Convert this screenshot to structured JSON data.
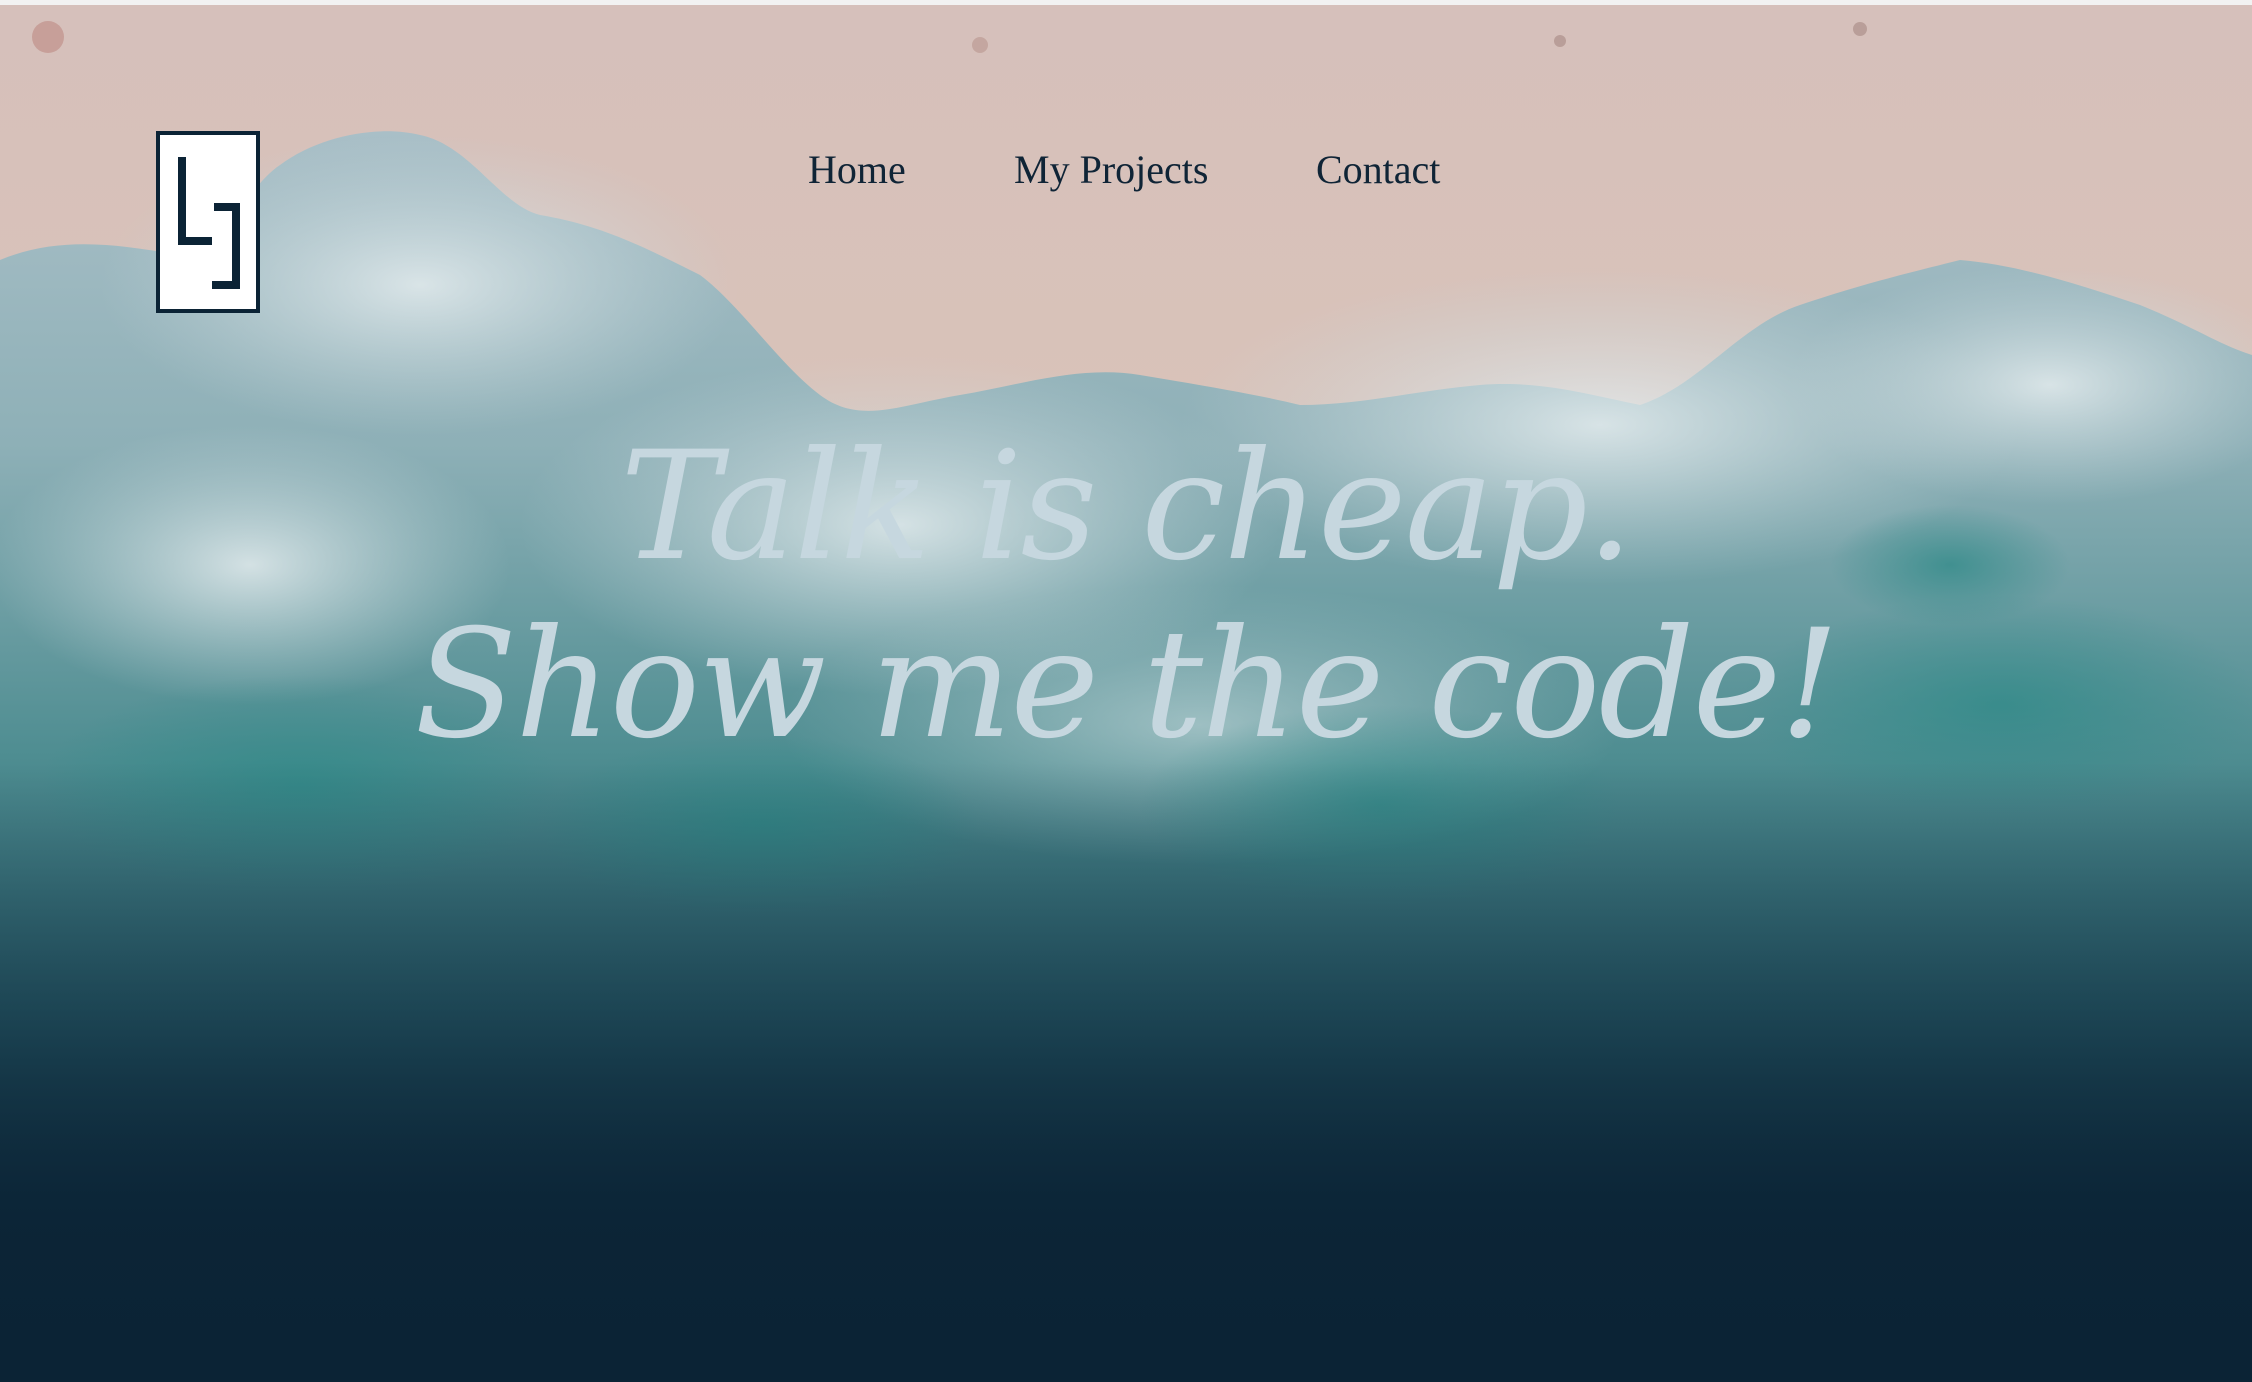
{
  "logo": {
    "icon": "ls-monogram-logo"
  },
  "nav": {
    "items": [
      {
        "label": "Home"
      },
      {
        "label": "My Projects"
      },
      {
        "label": "Contact"
      }
    ]
  },
  "hero": {
    "line1": "Talk is cheap.",
    "line2": "Show me the code!",
    "background": "aerial-beach-waves-photo"
  },
  "colors": {
    "navy": "#0b2335",
    "sand": "#dcc3bc",
    "headline": "#c6d7df",
    "sea": "#2f7a7e"
  }
}
